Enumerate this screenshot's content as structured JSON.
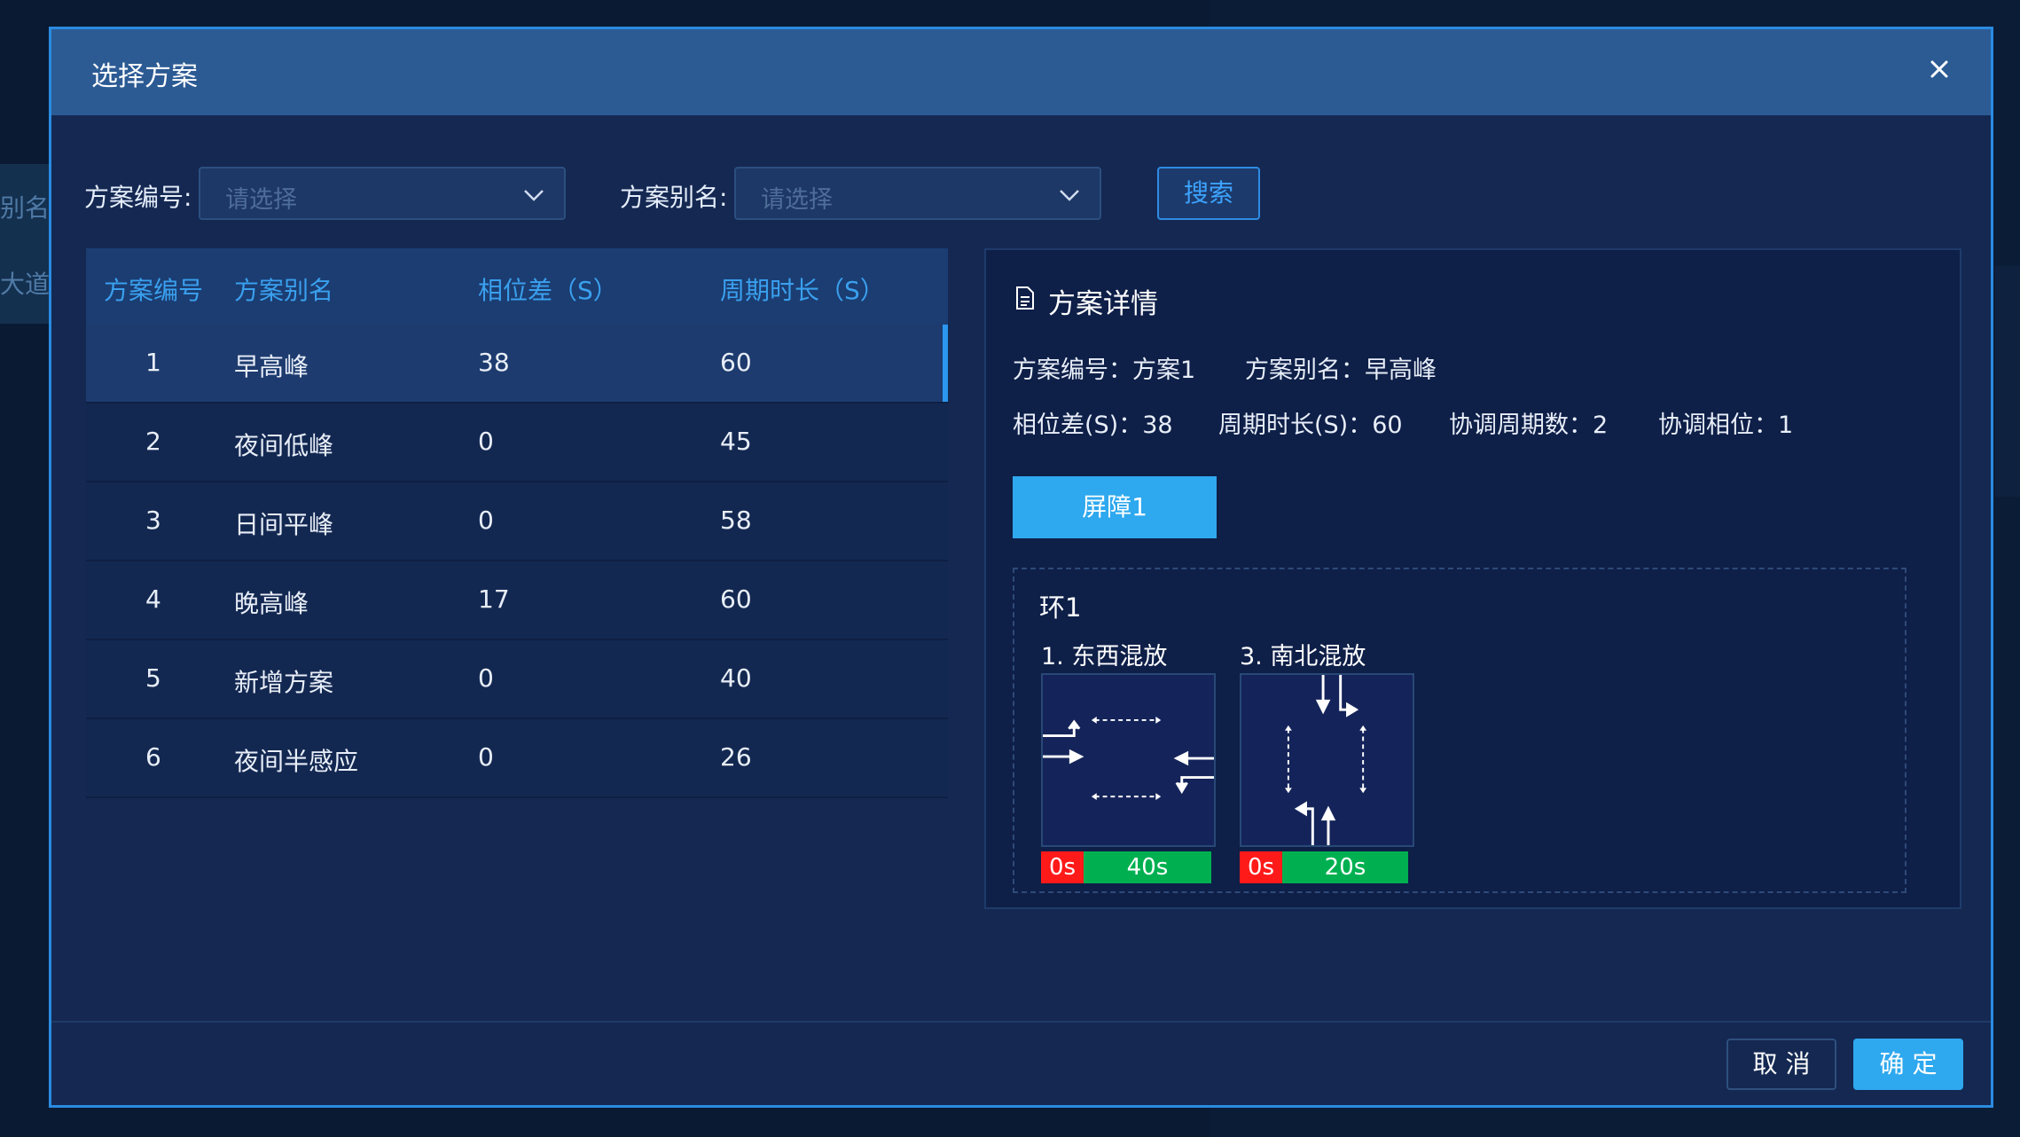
{
  "background": {
    "side_labels": [
      "别名",
      "大道"
    ]
  },
  "modal": {
    "title": "选择方案",
    "close_icon": "close-icon"
  },
  "filters": {
    "scheme_no_label": "方案编号:",
    "scheme_no_placeholder": "请选择",
    "alias_label": "方案别名:",
    "alias_placeholder": "请选择",
    "search_label": "搜索"
  },
  "table": {
    "headers": [
      "方案编号",
      "方案别名",
      "相位差（S）",
      "周期时长（S）"
    ],
    "rows": [
      {
        "no": "1",
        "alias": "早高峰",
        "offset": "38",
        "cycle": "60"
      },
      {
        "no": "2",
        "alias": "夜间低峰",
        "offset": "0",
        "cycle": "45"
      },
      {
        "no": "3",
        "alias": "日间平峰",
        "offset": "0",
        "cycle": "58"
      },
      {
        "no": "4",
        "alias": "晚高峰",
        "offset": "17",
        "cycle": "60"
      },
      {
        "no": "5",
        "alias": "新增方案",
        "offset": "0",
        "cycle": "40"
      },
      {
        "no": "6",
        "alias": "夜间半感应",
        "offset": "0",
        "cycle": "26"
      }
    ],
    "selected_index": 0
  },
  "detail": {
    "title": "方案详情",
    "scheme_no": "方案编号：方案1",
    "alias": "方案别名：早高峰",
    "offset": "相位差(S)：38",
    "cycle": "周期时长(S)：60",
    "coord_cycles": "协调周期数：2",
    "coord_phase": "协调相位：1",
    "tab": "屏障1",
    "ring": "环1",
    "phases": [
      {
        "name": "1. 东西混放",
        "red": "0s",
        "green": "40s",
        "icon": "east-west-phase-icon"
      },
      {
        "name": "3. 南北混放",
        "red": "0s",
        "green": "20s",
        "icon": "north-south-phase-icon"
      }
    ]
  },
  "footer": {
    "cancel": "取 消",
    "ok": "确 定"
  },
  "colors": {
    "accent": "#2ea8ee",
    "red": "#ff1a1a",
    "green": "#00b050"
  }
}
